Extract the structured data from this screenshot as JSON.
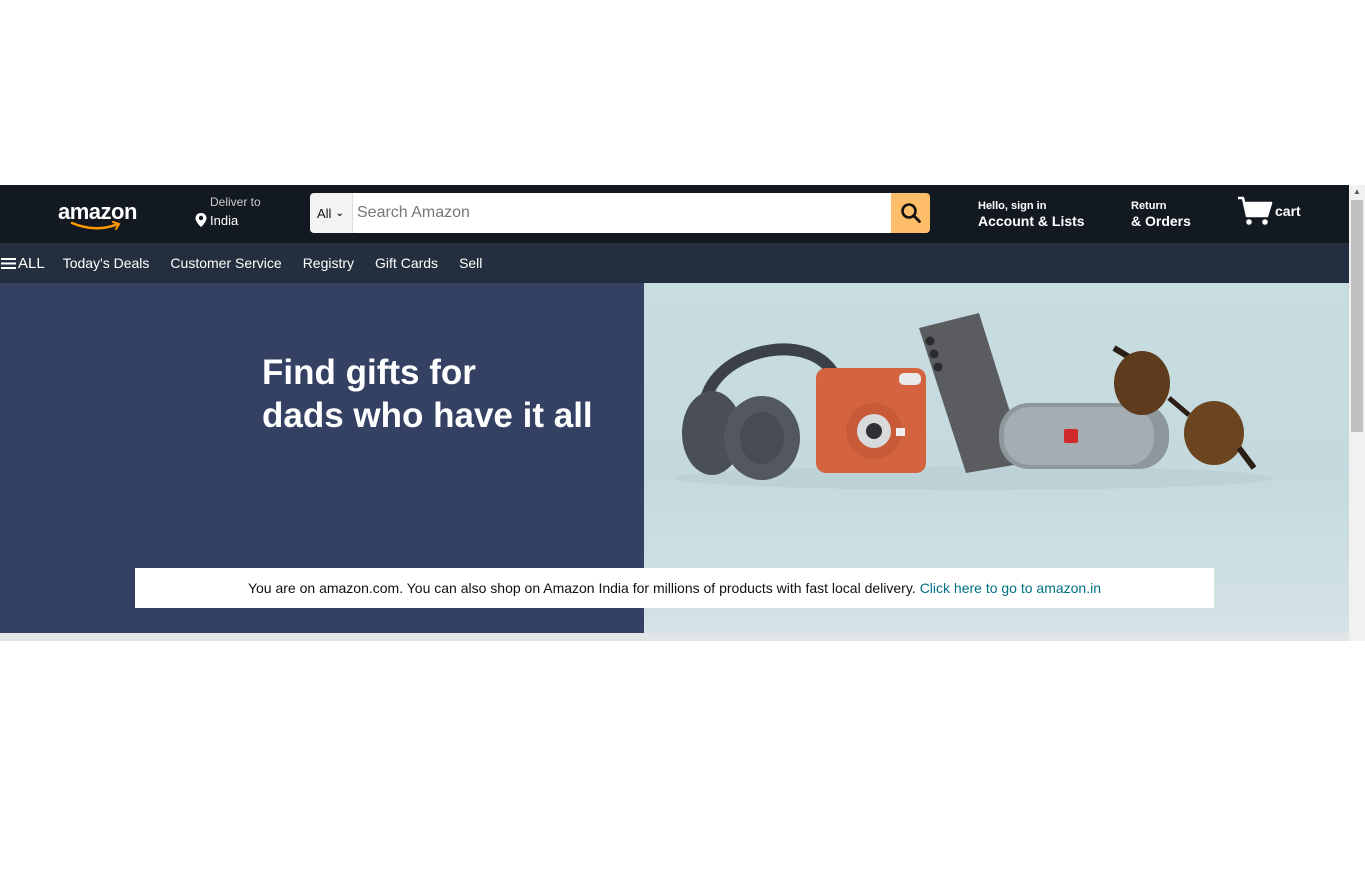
{
  "header": {
    "logo_text": "amazon",
    "deliver_label": "Deliver to",
    "deliver_location": "India",
    "search": {
      "category": "All",
      "placeholder": "Search Amazon"
    },
    "account_greeting": "Hello, sign in",
    "account_label": "Account & Lists",
    "returns_label": "Return",
    "orders_label": "& Orders",
    "cart_label": "cart"
  },
  "subnav": {
    "all_label": "ALL",
    "items": [
      {
        "label": "Today's Deals"
      },
      {
        "label": "Customer Service"
      },
      {
        "label": "Registry"
      },
      {
        "label": "Gift Cards"
      },
      {
        "label": "Sell"
      }
    ]
  },
  "hero": {
    "title_line1": "Find gifts for",
    "title_line2": "dads who have it all",
    "product_icons": [
      "headphones-icon",
      "instant-camera-icon",
      "smartphone-icon",
      "speaker-icon",
      "sunglasses-icon"
    ]
  },
  "notice": {
    "text": "You are on amazon.com. You can also shop on Amazon India for millions of products with fast local delivery.",
    "link_text": "Click here to go to amazon.in"
  },
  "colors": {
    "nav_bg": "#131921",
    "subnav_bg": "#232f3e",
    "search_button": "#febd69",
    "hero_left": "#344163",
    "hero_right": "#c8dde0",
    "link": "#007185",
    "logo_smile": "#ff9900"
  }
}
